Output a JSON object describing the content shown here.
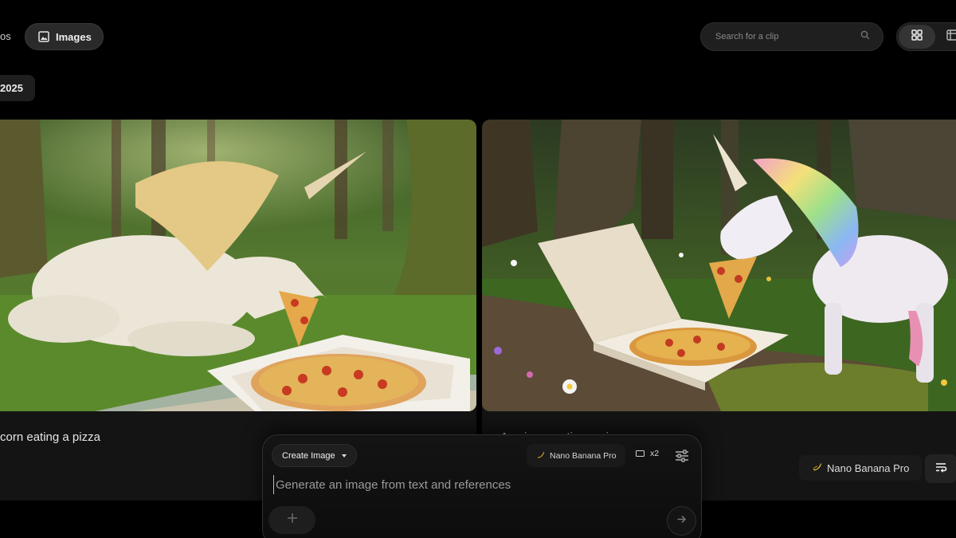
{
  "tabs": {
    "prev_label": "os",
    "images_label": "Images"
  },
  "search": {
    "placeholder": "Search for a clip"
  },
  "date_chip": "2025",
  "cards": [
    {
      "caption": "corn eating a pizza"
    },
    {
      "caption": "A unicorn eating a pizza"
    }
  ],
  "right_panel": {
    "model_label": "Nano Banana Pro"
  },
  "composer": {
    "mode_label": "Create Image",
    "model_label": "Nano Banana Pro",
    "count_label": "x2",
    "prompt_placeholder": "Generate an image from text and references"
  },
  "colors": {
    "background": "#000000",
    "card": "#141414",
    "chip": "#2a2a2a"
  },
  "icons": [
    "image-icon",
    "search-icon",
    "grid-view-icon",
    "list-view-icon",
    "banana-icon",
    "aspect-ratio-icon",
    "tune-icon",
    "plus-icon",
    "arrow-right-icon",
    "wrap-text-icon",
    "chevron-down-icon"
  ]
}
